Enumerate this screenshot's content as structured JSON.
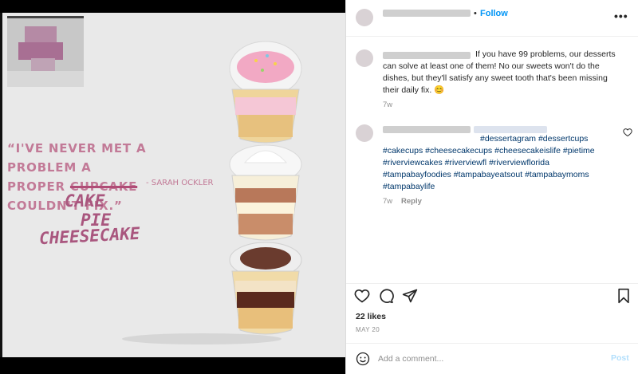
{
  "post": {
    "quote_open": "“I'VE NEVER MET A PROBLEM A",
    "quote_proper": "PROPER ",
    "quote_struck": "CUPCAKE",
    "quote_end": " COULDN'T FIX.”",
    "quote_author": "- SARAH OCKLER",
    "handwritten": [
      "CAKE",
      "PIE",
      "CHEESECAKE"
    ]
  },
  "header": {
    "follow_label": "Follow",
    "separator": "•",
    "more_icon": "more-horizontal-icon"
  },
  "caption": {
    "text": "If you have 99 problems, our desserts can solve at least one of them! No our sweets won't do the dishes, but they'll satisfy any sweet tooth that's been missing their daily fix. 😊",
    "age": "7w"
  },
  "hashtag_comment": {
    "tags": [
      "#dessertagram",
      "#dessertcups",
      "#cakecups",
      "#cheesecakecups",
      "#cheesecakeislife",
      "#pietime",
      "#riverviewcakes",
      "#riverviewfl",
      "#riverviewflorida",
      "#tampabayfoodies",
      "#tampabayeatsout",
      "#tampabaymoms",
      "#tampabaylife"
    ],
    "age": "7w",
    "reply_label": "Reply"
  },
  "actions": {
    "icons": [
      "heart-icon",
      "comment-icon",
      "share-icon",
      "bookmark-icon"
    ],
    "likes": "22 likes",
    "date": "MAY 20"
  },
  "add_comment": {
    "placeholder": "Add a comment...",
    "post_label": "Post"
  },
  "colors": {
    "accent_blue": "#0095f6",
    "hashtag": "#00376b",
    "quote_pink": "#c27a97",
    "handwriting": "#a9567e"
  }
}
